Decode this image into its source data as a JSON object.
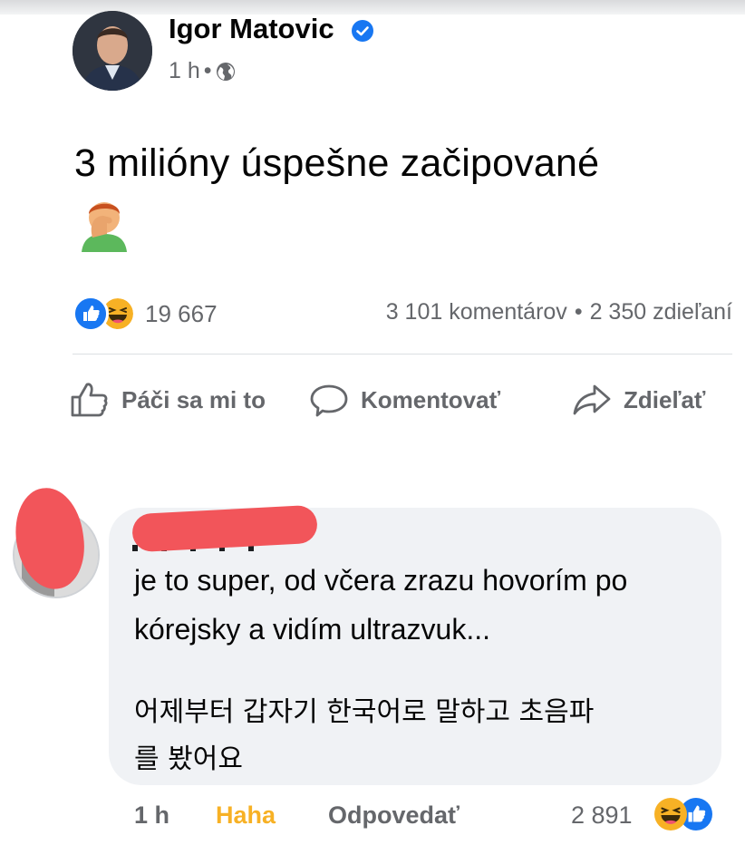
{
  "post": {
    "author": "Igor Matovic",
    "time": "1 h",
    "separator": "•",
    "text": "3 milióny úspešne začipované",
    "reaction_count": "19 667",
    "comments": "3 101 komentárov",
    "dot": "•",
    "shares": "2 350 zdieľaní",
    "icons": [
      "verified-badge-icon",
      "globe-icon",
      "like-reaction-icon",
      "haha-reaction-icon",
      "facepalm-emoji"
    ]
  },
  "actions": {
    "like": "Páči sa mi to",
    "comment": "Komentovať",
    "share": "Zdieľať"
  },
  "comment": {
    "line1": "je to super, od včera zrazu hovorím po",
    "line2": "kórejsky a vidím ultrazvuk...",
    "line3": "어제부터 갑자기 한국어로 말하고 초음파",
    "line4": "를 봤어요",
    "time": "1 h",
    "reaction_label": "Haha",
    "reply": "Odpovedať",
    "reaction_count": "2 891"
  },
  "colors": {
    "accent": "#1877f2",
    "haha": "#f7b125",
    "muted": "#65676b",
    "bubble": "#f0f2f5",
    "redaction": "#f2555a"
  }
}
